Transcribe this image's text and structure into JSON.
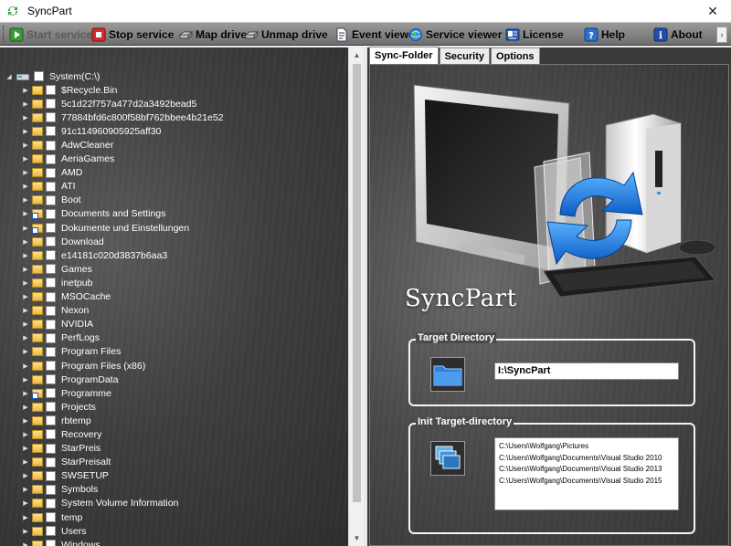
{
  "window": {
    "title": "SyncPart",
    "close_glyph": "✕"
  },
  "toolbar": {
    "buttons": [
      {
        "label": "Start service",
        "icon": "play-icon",
        "enabled": false
      },
      {
        "label": "Stop service",
        "icon": "stop-icon",
        "enabled": true
      },
      {
        "label": "Map drive",
        "icon": "drive-icon",
        "enabled": true
      },
      {
        "label": "Unmap drive",
        "icon": "drive-icon",
        "enabled": true
      },
      {
        "label": "Event viewer",
        "icon": "document-icon",
        "enabled": true
      },
      {
        "label": "Service viewer",
        "icon": "globe-icon",
        "enabled": true
      },
      {
        "label": "License",
        "icon": "license-icon",
        "enabled": true
      },
      {
        "label": "Help",
        "icon": "help-icon",
        "enabled": true
      },
      {
        "label": "About",
        "icon": "info-icon",
        "enabled": true
      }
    ],
    "overflow_glyph": "›"
  },
  "tree": {
    "root": "System(C:\\)",
    "items": [
      "$Recycle.Bin",
      "5c1d22f757a477d2a3492bead5",
      "77884bfd6c800f58bf762bbee4b21e52",
      "91c114960905925aff30",
      "AdwCleaner",
      "AeriaGames",
      "AMD",
      "ATI",
      "Boot",
      "Documents and Settings",
      "Dokumente und Einstellungen",
      "Download",
      "e14181c020d3837b6aa3",
      "Games",
      "inetpub",
      "MSOCache",
      "Nexon",
      "NVIDIA",
      "PerfLogs",
      "Program Files",
      "Program Files (x86)",
      "ProgramData",
      "Programme",
      "Projects",
      "rbtemp",
      "Recovery",
      "StarPreis",
      "StarPreisalt",
      "SWSETUP",
      "Symbols",
      "System Volume Information",
      "temp",
      "Users",
      "Windows"
    ],
    "shortcut_items": [
      "Documents and Settings",
      "Dokumente und Einstellungen",
      "Programme"
    ]
  },
  "tabs": [
    "Sync-Folder",
    "Security",
    "Options"
  ],
  "sync_folder": {
    "brand": "SyncPart",
    "target_directory": {
      "title": "Target Directory",
      "value": "I:\\SyncPart"
    },
    "init_target": {
      "title": "Init Target-directory",
      "items": [
        "C:\\Users\\Wolfgang\\Pictures",
        "C:\\Users\\Wolfgang\\Documents\\Visual Studio 2010",
        "C:\\Users\\Wolfgang\\Documents\\Visual Studio 2013",
        "C:\\Users\\Wolfgang\\Documents\\Visual Studio 2015"
      ]
    }
  },
  "colors": {
    "toolbar": "#7e7e7e",
    "pane_bg": "#3e3e3e",
    "sync_arrow": "#1e7fe0",
    "folder": "#f2c94c"
  }
}
